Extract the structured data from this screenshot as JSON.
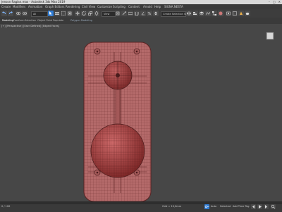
{
  "window": {
    "title": "Jenson Raglan.max - Autodesk 3ds Max 2019",
    "controls": {
      "minimize": "–",
      "maximize": "□",
      "close": "✕"
    }
  },
  "menu": {
    "items": [
      "Create",
      "Modifiers",
      "Animation",
      "Graph Editors",
      "Rendering",
      "Civil View",
      "Customize",
      "Scripting",
      "Content",
      "Arnold",
      "Help",
      "SIGNA.NESTA"
    ]
  },
  "toolbar": {
    "selection_filter": "All",
    "view_dropdown": "View",
    "named_selection": "Create Selection Se"
  },
  "ribbon": {
    "tabs": [
      "Modeling",
      "Freeform",
      "Selection",
      "Object Paint",
      "Populate"
    ],
    "subtabs": [
      "Polygon Modeling"
    ]
  },
  "viewport": {
    "label": "[+] [Perspective] [User Defined] [Edged Faces]",
    "mesh_color": "#b76a6a",
    "wire_color": "#6a2a2a"
  },
  "status": {
    "frame": "0 / 100",
    "grid": "Grid = 10,0mm",
    "auto": "Auto",
    "selected": "Selected",
    "add_time_tag": "Add Time Tag"
  },
  "colors": {
    "viewport_bg": "#474747",
    "accent": "#2f7bd3"
  },
  "icons": {
    "undo": "undo-icon",
    "redo": "redo-icon",
    "link": "link-icon",
    "unlink": "unlink-icon",
    "select": "select-icon",
    "move": "move-icon",
    "rotate": "rotate-icon",
    "scale": "scale-icon",
    "snap": "snap-icon",
    "render": "render-icon",
    "play": "play-icon",
    "key": "key-icon"
  }
}
